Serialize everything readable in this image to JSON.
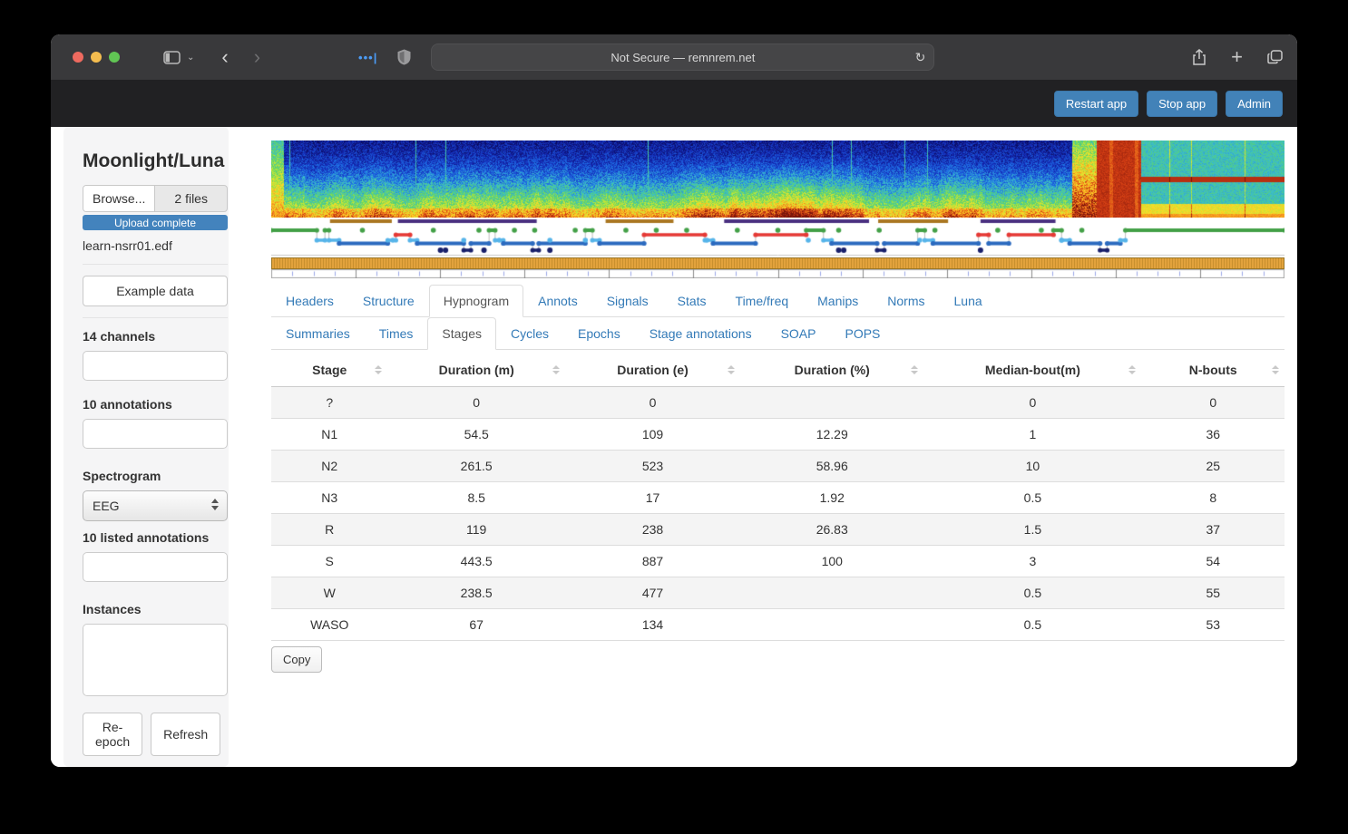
{
  "browser": {
    "address": "Not Secure — remnrem.net",
    "icons": {
      "back": "‹",
      "forward": "›",
      "chevron_down": "⌄",
      "reload": "↻",
      "ext_dots": "•••|",
      "plus": "+"
    }
  },
  "app_header": {
    "buttons": [
      {
        "label": "Restart app"
      },
      {
        "label": "Stop app"
      },
      {
        "label": "Admin"
      }
    ]
  },
  "sidebar": {
    "title": "Moonlight/Luna",
    "browse_label": "Browse...",
    "files_badge": "2 files",
    "upload_status": "Upload complete",
    "file_name": "learn-nsrr01.edf",
    "example_button": "Example data",
    "channels_label": "14 channels",
    "annotations_label": "10 annotations",
    "spectrogram_label": "Spectrogram",
    "spectrogram_value": "EEG",
    "listed_annotations_label": "10 listed annotations",
    "instances_label": "Instances",
    "reepoch_button": "Re-epoch",
    "refresh_button": "Refresh"
  },
  "tabs": {
    "primary": [
      "Headers",
      "Structure",
      "Hypnogram",
      "Annots",
      "Signals",
      "Stats",
      "Time/freq",
      "Manips",
      "Norms",
      "Luna"
    ],
    "active_primary": "Hypnogram",
    "secondary": [
      "Summaries",
      "Times",
      "Stages",
      "Cycles",
      "Epochs",
      "Stage annotations",
      "SOAP",
      "POPS"
    ],
    "active_secondary": "Stages"
  },
  "table": {
    "columns": [
      "Stage",
      "Duration (m)",
      "Duration (e)",
      "Duration (%)",
      "Median-bout(m)",
      "N-bouts"
    ],
    "col_widths_pct": [
      11.5,
      17.5,
      17.3,
      18.1,
      21.5,
      14.1
    ],
    "rows": [
      [
        "?",
        "0",
        "0",
        "",
        "0",
        "0"
      ],
      [
        "N1",
        "54.5",
        "109",
        "12.29",
        "1",
        "36"
      ],
      [
        "N2",
        "261.5",
        "523",
        "58.96",
        "10",
        "25"
      ],
      [
        "N3",
        "8.5",
        "17",
        "1.92",
        "0.5",
        "8"
      ],
      [
        "R",
        "119",
        "238",
        "26.83",
        "1.5",
        "37"
      ],
      [
        "S",
        "443.5",
        "887",
        "100",
        "3",
        "54"
      ],
      [
        "W",
        "238.5",
        "477",
        "",
        "0.5",
        "55"
      ],
      [
        "WASO",
        "67",
        "134",
        "",
        "0.5",
        "53"
      ]
    ]
  },
  "main": {
    "copy_label": "Copy"
  },
  "colors": {
    "accent_link": "#337ab7",
    "header_button_blue": "#4282b8",
    "progress_blue": "#4383bd"
  },
  "chart_data": {
    "type": "hypnogram",
    "stage_colors": {
      "W": "#43a047",
      "R": "#e53935",
      "N1": "#56b4e9",
      "N2": "#2b6abf",
      "N3": "#19206b"
    },
    "cycle_bar_colors": {
      "nrem": "#aa7722",
      "rem": "#4a3080"
    },
    "cycle_bars": [
      {
        "kind": "nrem",
        "a": 0.058,
        "b": 0.119
      },
      {
        "kind": "rem",
        "a": 0.125,
        "b": 0.262
      },
      {
        "kind": "nrem",
        "a": 0.33,
        "b": 0.397
      },
      {
        "kind": "rem",
        "a": 0.447,
        "b": 0.59
      },
      {
        "kind": "nrem",
        "a": 0.599,
        "b": 0.668
      },
      {
        "kind": "rem",
        "a": 0.7,
        "b": 0.774
      }
    ],
    "segments": [
      [
        "W",
        0.0,
        0.045
      ],
      [
        "N1",
        0.045,
        0.053
      ],
      [
        "W",
        0.053,
        0.057
      ],
      [
        "N1",
        0.057,
        0.067
      ],
      [
        "N2",
        0.067,
        0.115
      ],
      [
        "N1",
        0.115,
        0.123
      ],
      [
        "R",
        0.123,
        0.137
      ],
      [
        "N1",
        0.137,
        0.144
      ],
      [
        "N2",
        0.144,
        0.19
      ],
      [
        "N3",
        0.19,
        0.197
      ],
      [
        "N2",
        0.197,
        0.215
      ],
      [
        "W",
        0.215,
        0.221
      ],
      [
        "N1",
        0.221,
        0.229
      ],
      [
        "N2",
        0.229,
        0.258
      ],
      [
        "N3",
        0.258,
        0.264
      ],
      [
        "N2",
        0.264,
        0.31
      ],
      [
        "W",
        0.31,
        0.317
      ],
      [
        "N1",
        0.317,
        0.324
      ],
      [
        "N2",
        0.324,
        0.368
      ],
      [
        "R",
        0.368,
        0.428
      ],
      [
        "N1",
        0.428,
        0.436
      ],
      [
        "N2",
        0.436,
        0.478
      ],
      [
        "R",
        0.478,
        0.528
      ],
      [
        "W",
        0.528,
        0.545
      ],
      [
        "N1",
        0.545,
        0.553
      ],
      [
        "N2",
        0.553,
        0.598
      ],
      [
        "N3",
        0.598,
        0.605
      ],
      [
        "N2",
        0.605,
        0.638
      ],
      [
        "W",
        0.638,
        0.645
      ],
      [
        "N1",
        0.645,
        0.653
      ],
      [
        "N2",
        0.653,
        0.698
      ],
      [
        "R",
        0.698,
        0.708
      ],
      [
        "N2",
        0.708,
        0.728
      ],
      [
        "R",
        0.728,
        0.772
      ],
      [
        "W",
        0.772,
        0.78
      ],
      [
        "N1",
        0.78,
        0.788
      ],
      [
        "N2",
        0.788,
        0.818
      ],
      [
        "N3",
        0.818,
        0.825
      ],
      [
        "N2",
        0.825,
        0.838
      ],
      [
        "N1",
        0.838,
        0.843
      ],
      [
        "W",
        0.843,
        1.0
      ]
    ],
    "wake_dots": [
      0.09,
      0.16,
      0.205,
      0.24,
      0.26,
      0.3,
      0.35,
      0.38,
      0.41,
      0.46,
      0.5,
      0.56,
      0.6,
      0.655,
      0.717,
      0.76,
      0.8
    ],
    "n1_dots": [
      0.12,
      0.19,
      0.225,
      0.275,
      0.31,
      0.43,
      0.53,
      0.64,
      0.78
    ],
    "n3_dots": [
      0.167,
      0.172,
      0.21,
      0.275,
      0.56,
      0.565,
      0.7
    ],
    "tick_axis": {
      "major_divisions": 12,
      "minor_per_division": 4
    }
  }
}
